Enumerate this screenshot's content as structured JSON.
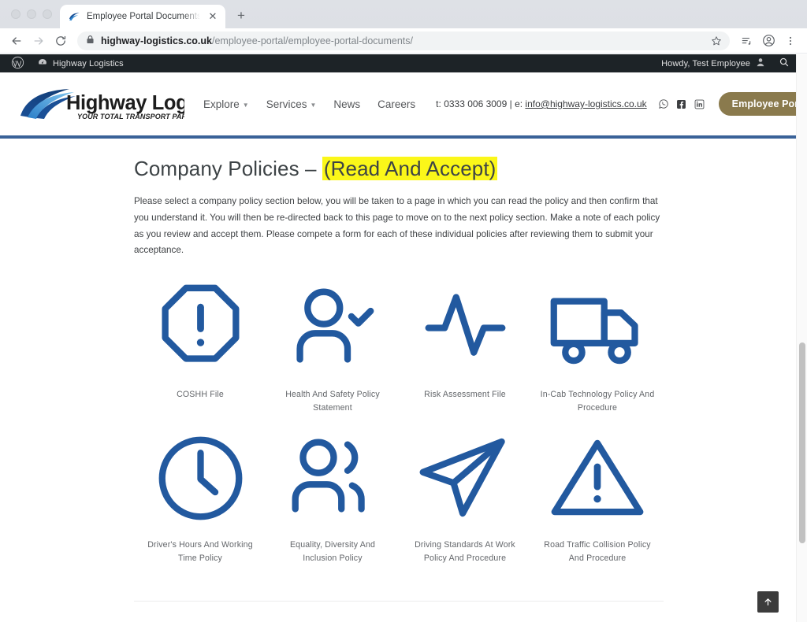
{
  "browser": {
    "tab": {
      "title": "Employee Portal Documents | ",
      "favicon": "highway-logistics-swoosh-favicon",
      "close_label": "✕"
    },
    "new_tab_label": "+",
    "nav": {
      "back": "←",
      "forward": "→",
      "reload": "↻"
    },
    "omnibox": {
      "lock_icon": "lock-icon",
      "url_domain": "highway-logistics.co.uk",
      "url_path": "/employee-portal/employee-portal-documents/",
      "bookmark_icon": "star-icon"
    },
    "toolbar_icons": [
      "reading-list-icon",
      "profile-avatar-icon",
      "chrome-menu-icon"
    ]
  },
  "adminbar": {
    "wp_logo": "wordpress-logo-icon",
    "site_icon": "dashboard-speedometer-icon",
    "site_name": "Highway Logistics",
    "howdy": "Howdy, Test Employee",
    "avatar_icon": "user-avatar-icon",
    "search_icon": "search-icon"
  },
  "site": {
    "logo": {
      "name": "Highway Logistics",
      "tagline": "YOUR TOTAL TRANSPORT PARTNER."
    },
    "nav": [
      {
        "label": "Explore",
        "has_dropdown": true
      },
      {
        "label": "Services",
        "has_dropdown": true
      },
      {
        "label": "News",
        "has_dropdown": false
      },
      {
        "label": "Careers",
        "has_dropdown": false
      }
    ],
    "contact": {
      "phone_prefix": "t: ",
      "phone": "0333 006 3009",
      "separator": " | ",
      "email_prefix": "e: ",
      "email": "info@highway-logistics.co.uk"
    },
    "socials": [
      "whatsapp-icon",
      "facebook-icon",
      "linkedin-icon"
    ],
    "portal_button": "Employee Portal",
    "accent_blue": "#3a6298",
    "portal_button_color": "#8a7a4d"
  },
  "page": {
    "title_plain": "Company Policies – ",
    "title_highlight": "(Read And Accept)",
    "highlight_color": "#fbf719",
    "intro": "Please select a company policy section below, you will be taken to a page in which you can read the policy and then confirm that you understand it. You will then be re-directed back to this page to move on to the next policy section. Make a note of each policy as you review and accept them. Please compete a form for each of these individual policies after reviewing them to submit your acceptance.",
    "icon_color": "#22599f",
    "policies": [
      {
        "label": "COSHH File",
        "icon": "octagon-exclamation-icon"
      },
      {
        "label": "Health And Safety Policy Statement",
        "icon": "person-check-icon"
      },
      {
        "label": "Risk Assessment File",
        "icon": "pulse-heartbeat-icon"
      },
      {
        "label": "In-Cab Technology Policy And Procedure",
        "icon": "truck-icon"
      },
      {
        "label": "Driver's Hours And Working Time Policy",
        "icon": "clock-icon"
      },
      {
        "label": "Equality, Diversity And Inclusion Policy",
        "icon": "people-group-icon"
      },
      {
        "label": "Driving Standards At Work Policy And Procedure",
        "icon": "paper-plane-icon"
      },
      {
        "label": "Road Traffic Collision Policy And Procedure",
        "icon": "triangle-warning-icon"
      }
    ],
    "scroll_top_label": "↑"
  }
}
